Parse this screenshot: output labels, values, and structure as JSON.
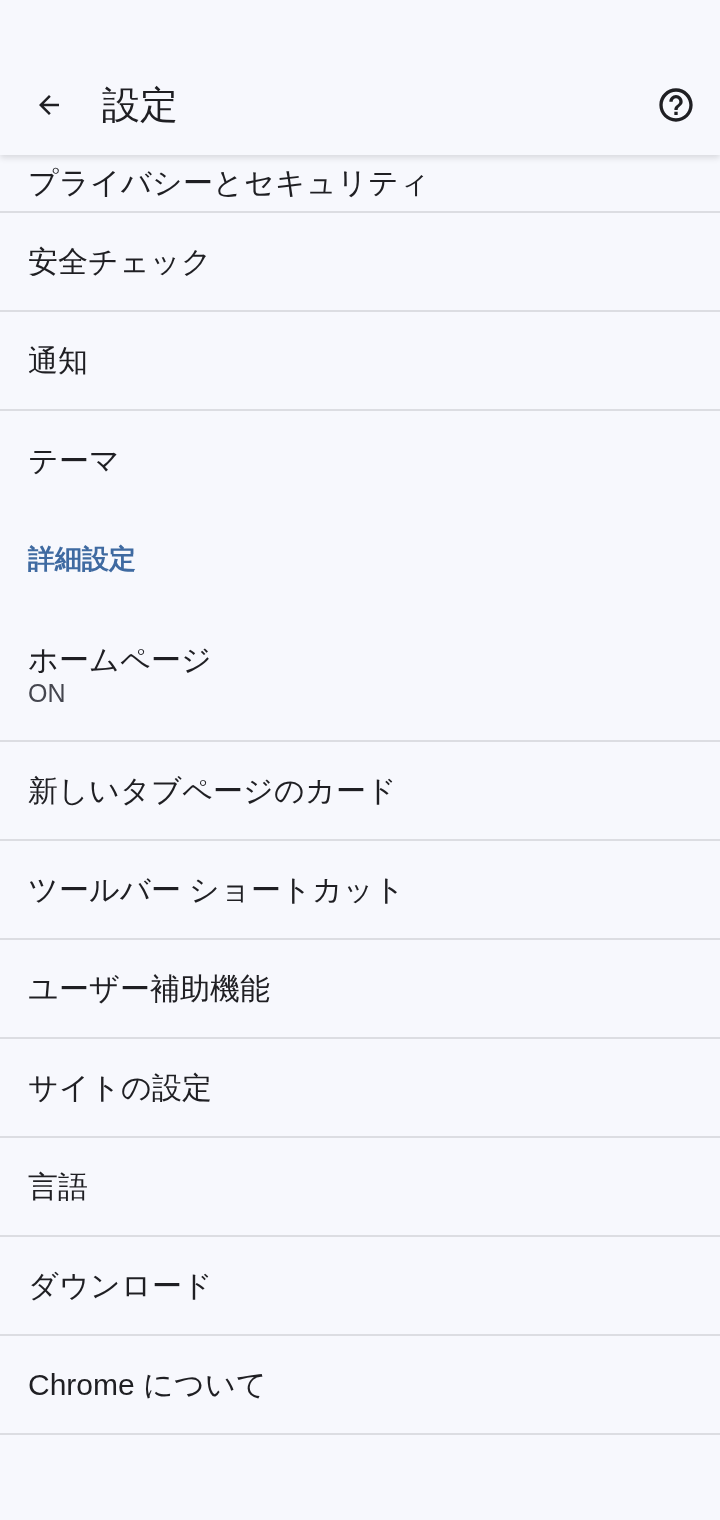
{
  "header": {
    "title": "設定"
  },
  "items": [
    {
      "kind": "row",
      "label": "プライバシーとセキュリティ"
    },
    {
      "kind": "row",
      "label": "安全チェック"
    },
    {
      "kind": "row",
      "label": "通知"
    },
    {
      "kind": "row",
      "label": "テーマ"
    },
    {
      "kind": "section",
      "label": "詳細設定"
    },
    {
      "kind": "row",
      "label": "ホームページ",
      "summary": "ON"
    },
    {
      "kind": "row",
      "label": "新しいタブページのカード"
    },
    {
      "kind": "row",
      "label": "ツールバー ショートカット"
    },
    {
      "kind": "row",
      "label": "ユーザー補助機能"
    },
    {
      "kind": "row",
      "label": "サイトの設定"
    },
    {
      "kind": "row",
      "label": "言語"
    },
    {
      "kind": "row",
      "label": "ダウンロード"
    },
    {
      "kind": "row",
      "label": "Chrome について"
    }
  ]
}
